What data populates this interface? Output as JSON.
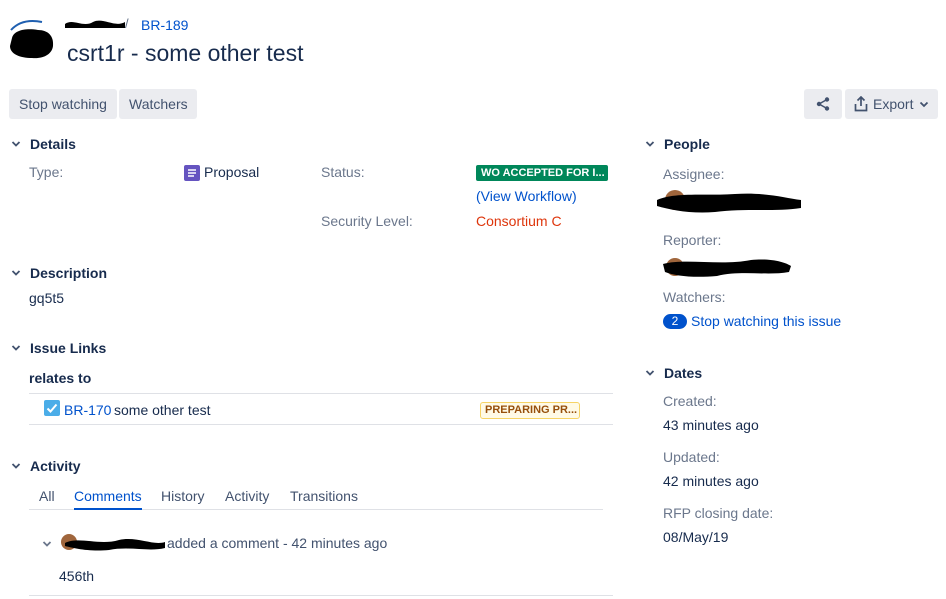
{
  "breadcrumb": {
    "separator": "/",
    "issue_key": "BR-189"
  },
  "issue": {
    "title": "csrt1r - some other test"
  },
  "toolbar": {
    "stop_watching": "Stop watching",
    "watchers": "Watchers",
    "export": "Export"
  },
  "details": {
    "heading": "Details",
    "type_label": "Type:",
    "type_value": "Proposal",
    "status_label": "Status:",
    "status_value": "WO ACCEPTED FOR I...",
    "view_workflow": "(View Workflow)",
    "security_label": "Security Level:",
    "security_value": "Consortium C"
  },
  "description": {
    "heading": "Description",
    "text": "gq5t5"
  },
  "issue_links": {
    "heading": "Issue Links",
    "relation": "relates to",
    "items": [
      {
        "key": "BR-170",
        "summary": "some other test",
        "status": "PREPARING PR..."
      }
    ]
  },
  "activity": {
    "heading": "Activity",
    "tabs": [
      "All",
      "Comments",
      "History",
      "Activity",
      "Transitions"
    ],
    "active_tab": "Comments",
    "comment": {
      "action": "added a comment - 42 minutes ago",
      "body": "456th"
    }
  },
  "people": {
    "heading": "People",
    "assignee_label": "Assignee:",
    "reporter_label": "Reporter:",
    "watchers_label": "Watchers:",
    "watch_count": "2",
    "stop_watching_link": "Stop watching this issue"
  },
  "dates": {
    "heading": "Dates",
    "created_label": "Created:",
    "created_value": "43 minutes ago",
    "updated_label": "Updated:",
    "updated_value": "42 minutes ago",
    "rfp_label": "RFP closing date:",
    "rfp_value": "08/May/19"
  },
  "colors": {
    "accent": "#0052cc",
    "status_green": "#00875a",
    "security_red": "#de350b",
    "text": "#172b4d",
    "muted": "#6b778c"
  }
}
